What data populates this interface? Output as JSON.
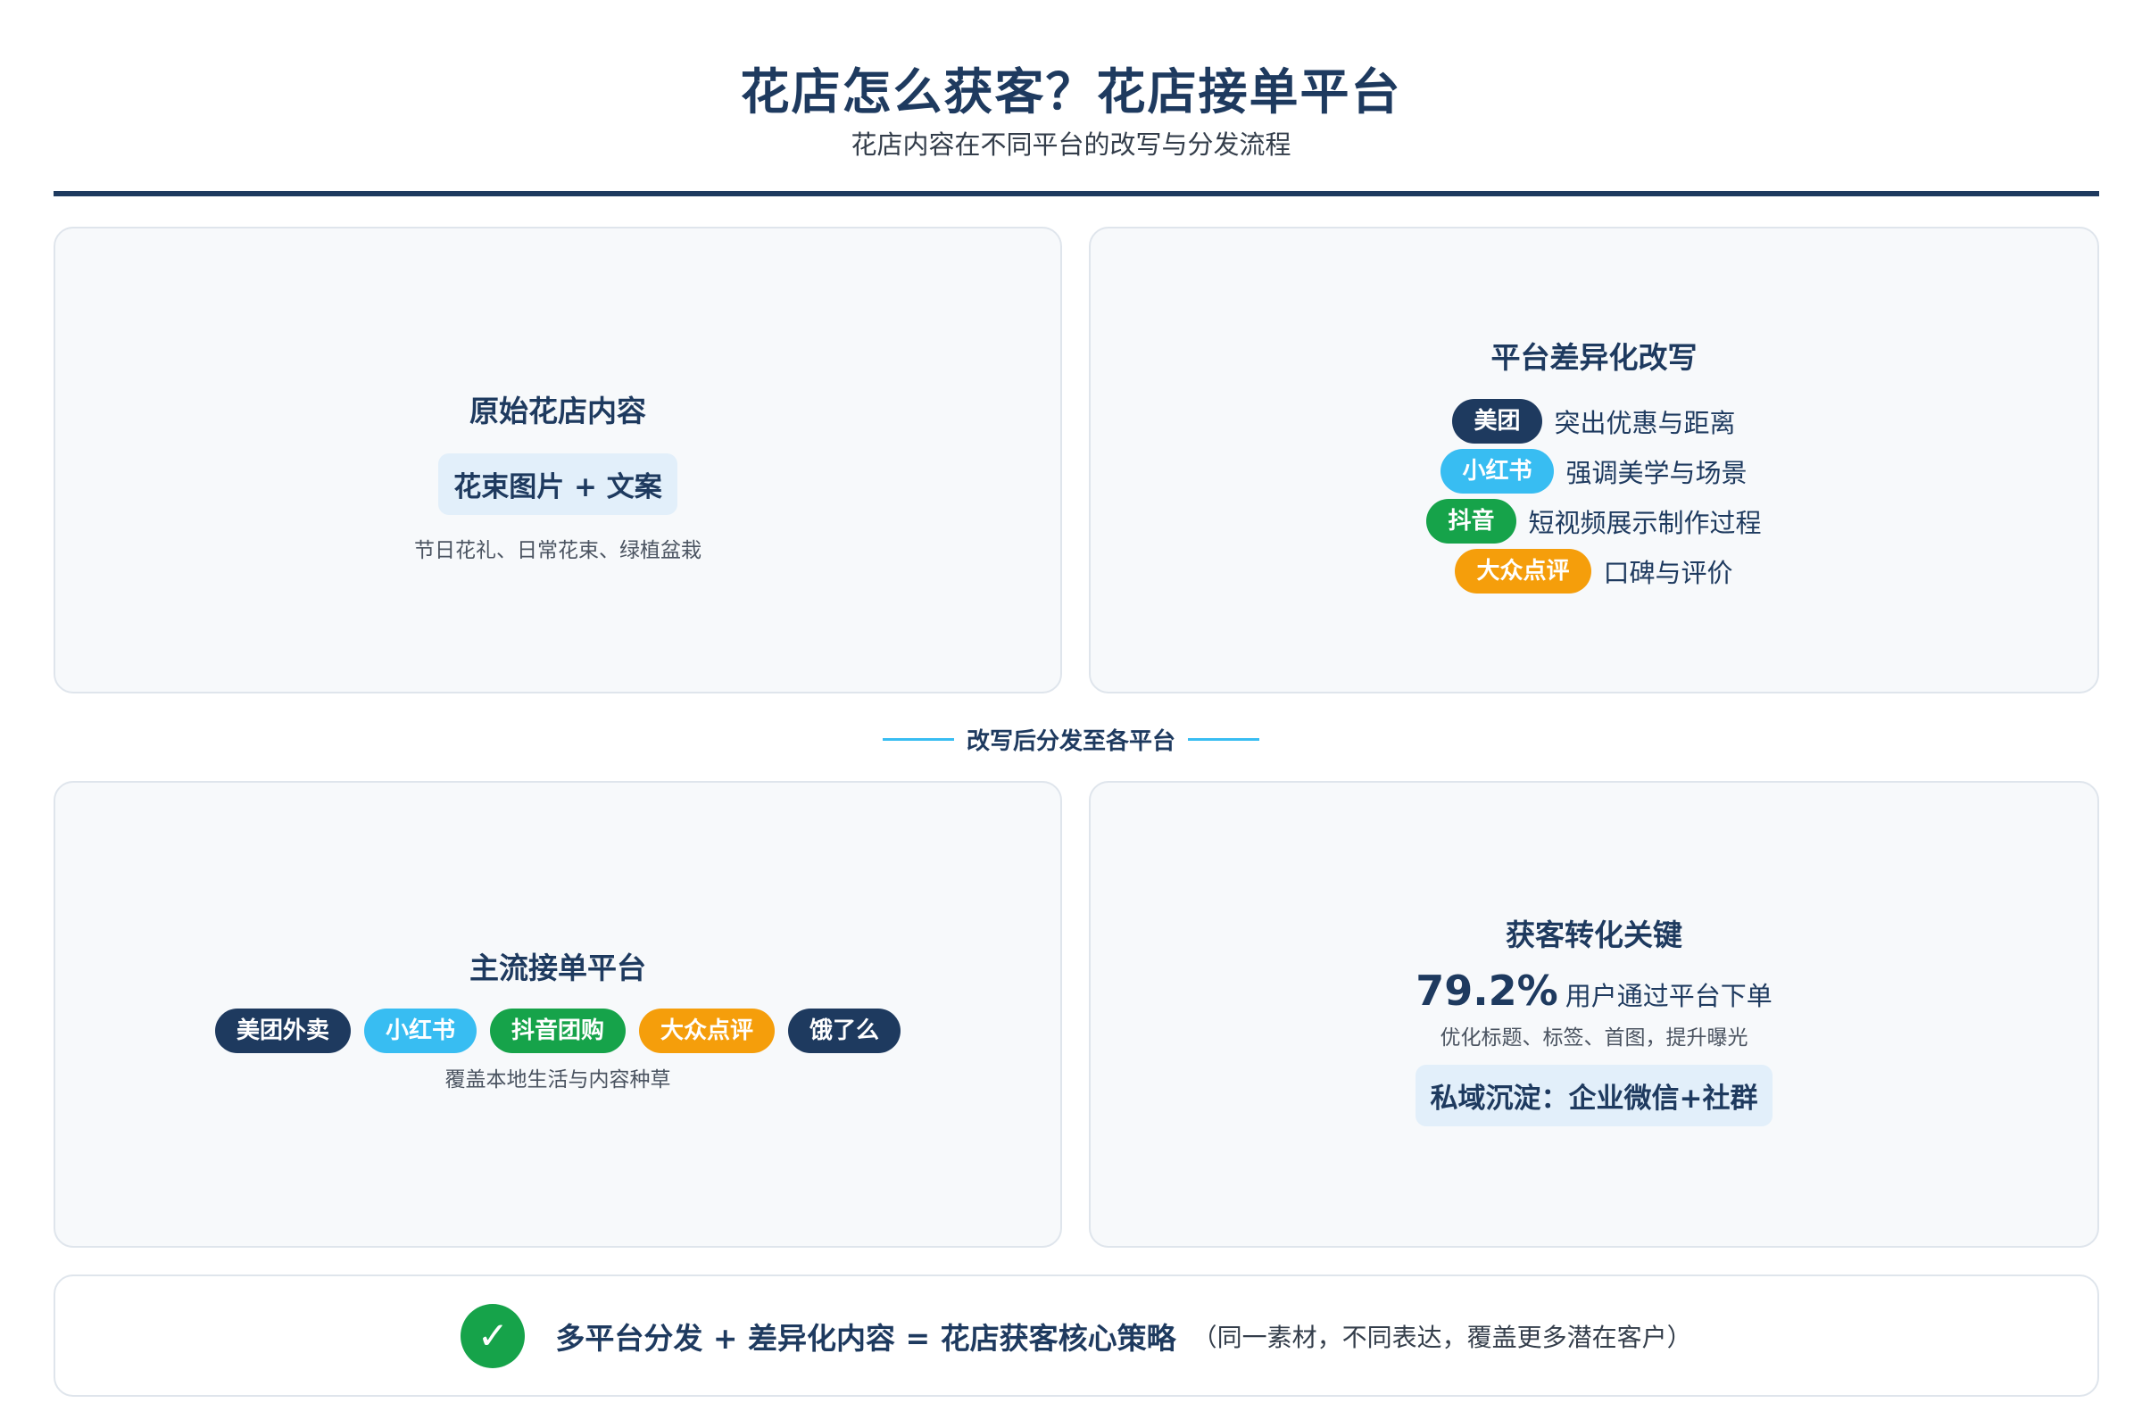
{
  "header": {
    "title": "花店怎么获客？花店接单平台",
    "subtitle": "花店内容在不同平台的改写与分发流程"
  },
  "source_card": {
    "title": "原始花店内容",
    "highlight": "花束图片 + 文案",
    "note": "节日花礼、日常花束、绿植盆栽"
  },
  "rewrite_card": {
    "title": "平台差异化改写",
    "rows": [
      {
        "platform": "美团",
        "desc": "突出优惠与距离",
        "color": "#1e3a5f"
      },
      {
        "platform": "小红书",
        "desc": "强调美学与场景",
        "color": "#38bdf2"
      },
      {
        "platform": "抖音",
        "desc": "短视频展示制作过程",
        "color": "#16a34a"
      },
      {
        "platform": "大众点评",
        "desc": "口碑与评价",
        "color": "#f59e0b"
      }
    ]
  },
  "flow_label": "改写后分发至各平台",
  "platforms_card": {
    "title": "主流接单平台",
    "pills": [
      "美团外卖",
      "小红书",
      "抖音团购",
      "大众点评",
      "饿了么"
    ],
    "note": "覆盖本地生活与内容种草"
  },
  "conversion_card": {
    "title": "获客转化关键",
    "stat_value": "79.2%",
    "stat_desc": "用户通过平台下单",
    "note": "优化标题、标签、首图，提升曝光",
    "highlight": "私域沉淀：企业微信+社群"
  },
  "footer": {
    "check_glyph": "✓",
    "main": "多平台分发 + 差异化内容 = 花店获客核心策略",
    "note": "（同一素材，不同表达，覆盖更多潜在客户）"
  },
  "colors": {
    "navy": "#1e3a5f",
    "sky": "#38bdf2",
    "green": "#16a34a",
    "orange": "#f59e0b"
  }
}
